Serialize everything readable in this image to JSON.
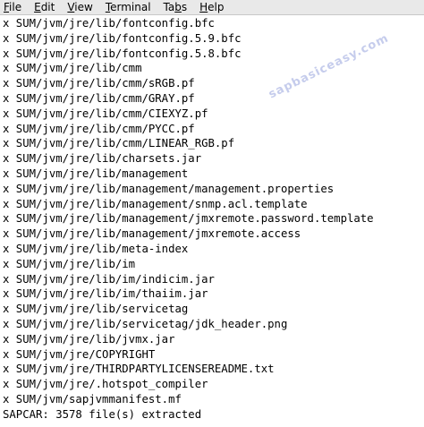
{
  "menu": {
    "items": [
      {
        "label": "File",
        "mnemonic": "F",
        "rest": "ile"
      },
      {
        "label": "Edit",
        "mnemonic": "E",
        "rest": "dit"
      },
      {
        "label": "View",
        "mnemonic": "V",
        "rest": "iew"
      },
      {
        "label": "Terminal",
        "mnemonic": "T",
        "rest": "erminal"
      },
      {
        "label": "Tabs",
        "mnemonic": "",
        "pre": "Ta",
        "mnemonic2": "b",
        "rest": "s"
      },
      {
        "label": "Help",
        "mnemonic": "H",
        "rest": "elp"
      }
    ]
  },
  "terminal": {
    "lines": [
      "x SUM/jvm/jre/lib/fontconfig.bfc",
      "x SUM/jvm/jre/lib/fontconfig.5.9.bfc",
      "x SUM/jvm/jre/lib/fontconfig.5.8.bfc",
      "x SUM/jvm/jre/lib/cmm",
      "x SUM/jvm/jre/lib/cmm/sRGB.pf",
      "x SUM/jvm/jre/lib/cmm/GRAY.pf",
      "x SUM/jvm/jre/lib/cmm/CIEXYZ.pf",
      "x SUM/jvm/jre/lib/cmm/PYCC.pf",
      "x SUM/jvm/jre/lib/cmm/LINEAR_RGB.pf",
      "x SUM/jvm/jre/lib/charsets.jar",
      "x SUM/jvm/jre/lib/management",
      "x SUM/jvm/jre/lib/management/management.properties",
      "x SUM/jvm/jre/lib/management/snmp.acl.template",
      "x SUM/jvm/jre/lib/management/jmxremote.password.template",
      "x SUM/jvm/jre/lib/management/jmxremote.access",
      "x SUM/jvm/jre/lib/meta-index",
      "x SUM/jvm/jre/lib/im",
      "x SUM/jvm/jre/lib/im/indicim.jar",
      "x SUM/jvm/jre/lib/im/thaiim.jar",
      "x SUM/jvm/jre/lib/servicetag",
      "x SUM/jvm/jre/lib/servicetag/jdk_header.png",
      "x SUM/jvm/jre/lib/jvmx.jar",
      "x SUM/jvm/jre/COPYRIGHT",
      "x SUM/jvm/jre/THIRDPARTYLICENSEREADME.txt",
      "x SUM/jvm/jre/.hotspot_compiler",
      "x SUM/jvm/sapjvmmanifest.mf",
      "SAPCAR: 3578 file(s) extracted"
    ]
  },
  "watermark": "sapbasiceasy.com",
  "colors": {
    "menubar_bg": "#e9e9e9",
    "terminal_bg": "#ffffff",
    "text": "#000000"
  }
}
